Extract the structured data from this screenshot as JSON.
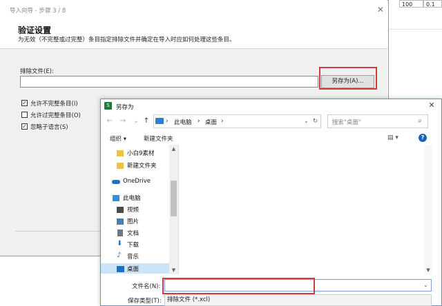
{
  "background": {
    "cells": [
      "...",
      "100"
    ],
    "right_values": [
      "100",
      "0.1"
    ]
  },
  "wizard": {
    "title": "导入向导 - 步骤 3 / 8",
    "heading": "验证设置",
    "subtitle": "为无效（不完整或过完整）条目指定排除文件并确定在导入时应如何处理这些条目。",
    "exclude_label": "排除文件(E):",
    "exclude_value": "",
    "saveas_button": "另存为(A)...",
    "checkboxes": [
      {
        "label": "允许不完整条目(I)",
        "checked": true
      },
      {
        "label": "允许过完整条目(O)",
        "checked": false
      },
      {
        "label": "忽略子语言(S)",
        "checked": true
      }
    ],
    "close_glyph": "✕"
  },
  "saveas": {
    "title": "另存为",
    "app_icon_glyph": "S",
    "close_glyph": "✕",
    "nav": {
      "back": "←",
      "forward": "→",
      "down": "⌄",
      "up": "↑"
    },
    "address": [
      "此电脑",
      "›",
      "桌面",
      "›"
    ],
    "address_root_chevron": "›",
    "refresh": "↻",
    "search_placeholder": "搜索\"桌面\"",
    "search_glyph": "⌕",
    "toolbar": {
      "organize": "组织 ▾",
      "new_folder": "新建文件夹",
      "view": "▤ ▾",
      "help": "?"
    },
    "nav_items": [
      {
        "label": "小白9素材",
        "icon": "folder-icon",
        "color": "#e8c24a"
      },
      {
        "label": "新建文件夹",
        "icon": "folder-icon",
        "color": "#e8c24a"
      },
      {
        "label": "OneDrive",
        "icon": "cloud-icon",
        "color": "#1f6fc5"
      },
      {
        "label": "此电脑",
        "icon": "computer-icon",
        "color": "#3b8bd9"
      },
      {
        "label": "视频",
        "icon": "video-icon",
        "color": "#4a4a4a"
      },
      {
        "label": "图片",
        "icon": "picture-icon",
        "color": "#4a7fb0"
      },
      {
        "label": "文档",
        "icon": "document-icon",
        "color": "#6b7a8a"
      },
      {
        "label": "下载",
        "icon": "download-icon",
        "color": "#1f6fc5"
      },
      {
        "label": "音乐",
        "icon": "music-icon",
        "color": "#1f6fc5"
      },
      {
        "label": "桌面",
        "icon": "desktop-icon",
        "color": "#1f6fc5"
      }
    ],
    "scroll_up": "▲",
    "scroll_down": "▼",
    "filename_label": "文件名(N):",
    "filename_value": "",
    "filename_drop": "⌄",
    "filetype_label": "保存类型(T):",
    "filetype_value": "排除文件 (*.xcl)"
  },
  "colors": {
    "highlight": "#d23b3b",
    "accent": "#1f6fc5"
  }
}
